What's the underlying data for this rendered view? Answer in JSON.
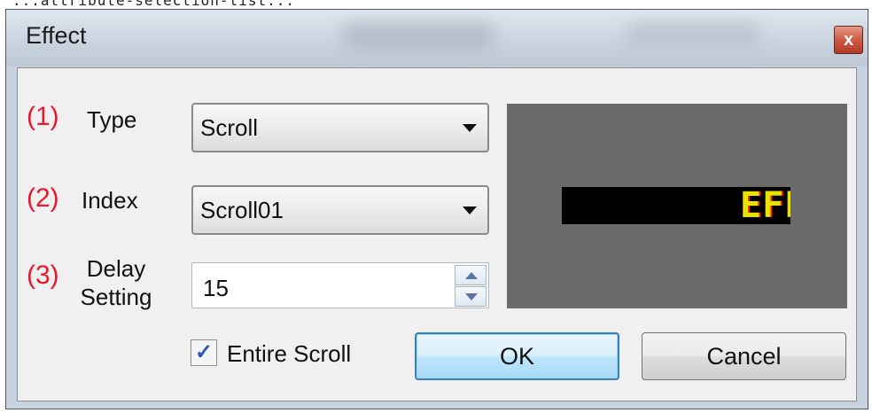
{
  "top_strip_text": "...attribute-selection-list...",
  "window": {
    "title": "Effect",
    "close_glyph": "x",
    "close_icon": "close-icon"
  },
  "form": {
    "type": {
      "number": "(1)",
      "label": "Type",
      "value": "Scroll"
    },
    "index": {
      "number": "(2)",
      "label": "Index",
      "value": "Scroll01"
    },
    "delay": {
      "number": "(3)",
      "label_line1": "Delay",
      "label_line2": "Setting",
      "value": "15"
    }
  },
  "preview": {
    "led_text": "EFF",
    "colors": {
      "background": "#6a6a6a",
      "strip": "#000000",
      "text_main": "#e8e400",
      "text_green": "#22e000",
      "text_red": "#ff2020"
    }
  },
  "options": {
    "entire_scroll_label": "Entire Scroll",
    "entire_scroll_checked": true
  },
  "buttons": {
    "ok": "OK",
    "cancel": "Cancel"
  },
  "colors": {
    "step_number": "#e8192c",
    "ok_border": "#3c7fb1",
    "close_red": "#cf5a43"
  }
}
